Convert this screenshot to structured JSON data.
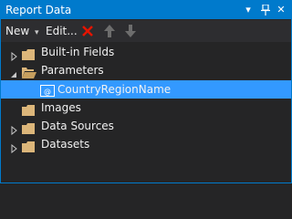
{
  "window": {
    "title": "Report Data"
  },
  "titlebar_buttons": {
    "menu": "▾",
    "pin": "ᵖ",
    "close": "✕"
  },
  "toolbar": {
    "new_label": "New",
    "new_arrow": "▾",
    "edit_label": "Edit...",
    "delete_icon": "delete-icon",
    "move_up_icon": "move-up-icon",
    "move_down_icon": "move-down-icon"
  },
  "tree": {
    "items": [
      {
        "label": "Built-in Fields",
        "expanded": false,
        "selected": false
      },
      {
        "label": "Parameters",
        "expanded": true,
        "selected": false,
        "children": [
          {
            "label": "CountryRegionName",
            "selected": true
          }
        ]
      },
      {
        "label": "Images",
        "expanded": false,
        "selected": false
      },
      {
        "label": "Data Sources",
        "expanded": false,
        "selected": false
      },
      {
        "label": "Datasets",
        "expanded": false,
        "selected": false
      }
    ]
  },
  "colors": {
    "accent": "#007acc",
    "selection": "#3399ff",
    "background": "#252526",
    "folder": "#dcb67a",
    "delete_red": "#e51400"
  }
}
